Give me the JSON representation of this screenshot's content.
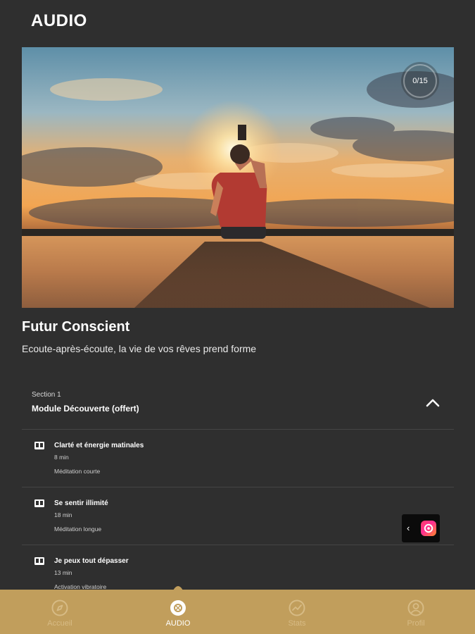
{
  "header": {
    "title": "AUDIO"
  },
  "hero": {
    "progress_label": "0/15",
    "progress_fraction": 0.0
  },
  "program": {
    "title": "Futur Conscient",
    "subtitle": "Ecoute-après-écoute, la vie de vos rêves prend forme"
  },
  "section": {
    "label": "Section 1",
    "name": "Module Découverte (offert)",
    "expanded": true
  },
  "lessons": [
    {
      "title": "Clarté et énergie matinales",
      "duration": "8 min",
      "type": "Méditation courte",
      "icon": "book-icon"
    },
    {
      "title": "Se sentir illimité",
      "duration": "18 min",
      "type": "Méditation longue",
      "icon": "book-icon"
    },
    {
      "title": "Je peux tout dépasser",
      "duration": "13 min",
      "type": "Activation vibratoire",
      "icon": "book-icon"
    }
  ],
  "floating_widget": {
    "chevron": "‹"
  },
  "nav": {
    "items": [
      {
        "label": "Accueil",
        "icon": "compass-icon",
        "active": false
      },
      {
        "label": "AUDIO",
        "icon": "audio-icon",
        "active": true
      },
      {
        "label": "Stats",
        "icon": "stats-icon",
        "active": false
      },
      {
        "label": "Profil",
        "icon": "profile-icon",
        "active": false
      }
    ]
  },
  "colors": {
    "background": "#2f2f2f",
    "nav_bar": "#c19e5c",
    "nav_inactive": "#d7bb85",
    "divider": "#454545",
    "text": "#ffffff"
  }
}
